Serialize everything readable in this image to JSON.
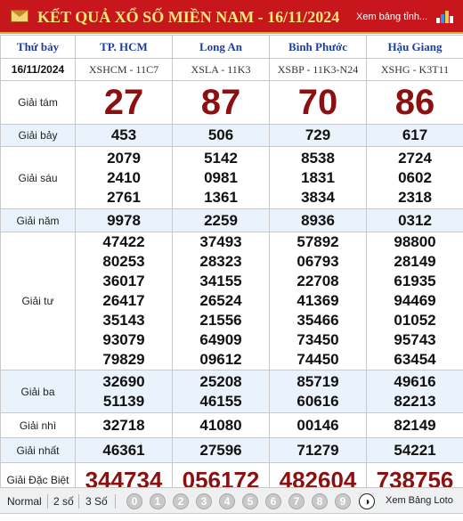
{
  "header": {
    "title": "KẾT QUẢ XỔ SỐ MIỀN NAM - 16/11/2024",
    "link": "Xem bảng tỉnh...",
    "chart_icon": "bar-chart-icon",
    "mail_icon": "mail-icon"
  },
  "table": {
    "day": "Thứ bảy",
    "date": "16/11/2024",
    "provinces": [
      {
        "name": "TP. HCM",
        "code": "XSHCM - 11C7"
      },
      {
        "name": "Long An",
        "code": "XSLA - 11K3"
      },
      {
        "name": "Bình Phước",
        "code": "XSBP - 11K3-N24"
      },
      {
        "name": "Hậu Giang",
        "code": "XSHG - K3T11"
      }
    ],
    "prizes": [
      {
        "label": "Giải tám",
        "values": [
          [
            "27"
          ],
          [
            "87"
          ],
          [
            "70"
          ],
          [
            "86"
          ]
        ]
      },
      {
        "label": "Giải bảy",
        "values": [
          [
            "453"
          ],
          [
            "506"
          ],
          [
            "729"
          ],
          [
            "617"
          ]
        ]
      },
      {
        "label": "Giải sáu",
        "values": [
          [
            "2079",
            "2410",
            "2761"
          ],
          [
            "5142",
            "0981",
            "1361"
          ],
          [
            "8538",
            "1831",
            "3834"
          ],
          [
            "2724",
            "0602",
            "2318"
          ]
        ]
      },
      {
        "label": "Giải năm",
        "values": [
          [
            "9978"
          ],
          [
            "2259"
          ],
          [
            "8936"
          ],
          [
            "0312"
          ]
        ]
      },
      {
        "label": "Giải tư",
        "values": [
          [
            "47422",
            "80253",
            "36017",
            "26417",
            "35143",
            "93079",
            "79829"
          ],
          [
            "37493",
            "28323",
            "34155",
            "26524",
            "21556",
            "64909",
            "09612"
          ],
          [
            "57892",
            "06793",
            "22708",
            "41369",
            "35466",
            "73450",
            "74450"
          ],
          [
            "98800",
            "28149",
            "61935",
            "94469",
            "01052",
            "95743",
            "63454"
          ]
        ]
      },
      {
        "label": "Giải ba",
        "values": [
          [
            "32690",
            "51139"
          ],
          [
            "25208",
            "46155"
          ],
          [
            "85719",
            "60616"
          ],
          [
            "49616",
            "82213"
          ]
        ]
      },
      {
        "label": "Giải nhì",
        "values": [
          [
            "32718"
          ],
          [
            "41080"
          ],
          [
            "00146"
          ],
          [
            "82149"
          ]
        ]
      },
      {
        "label": "Giải nhất",
        "values": [
          [
            "46361"
          ],
          [
            "27596"
          ],
          [
            "71279"
          ],
          [
            "54221"
          ]
        ]
      },
      {
        "label": "Giải Đặc Biệt",
        "values": [
          [
            "344734"
          ],
          [
            "056172"
          ],
          [
            "482604"
          ],
          [
            "738756"
          ]
        ]
      }
    ]
  },
  "footer": {
    "modes": [
      "Normal",
      "2 số",
      "3 Số"
    ],
    "digits": [
      "0",
      "1",
      "2",
      "3",
      "4",
      "5",
      "6",
      "7",
      "8",
      "9"
    ],
    "loto_link": "Xem Bảng Loto"
  },
  "colors": {
    "header_bg": "#c8161d",
    "title_text": "#ffe97a",
    "province_text": "#1f3f9e",
    "special_numbers": "#8c1010"
  }
}
